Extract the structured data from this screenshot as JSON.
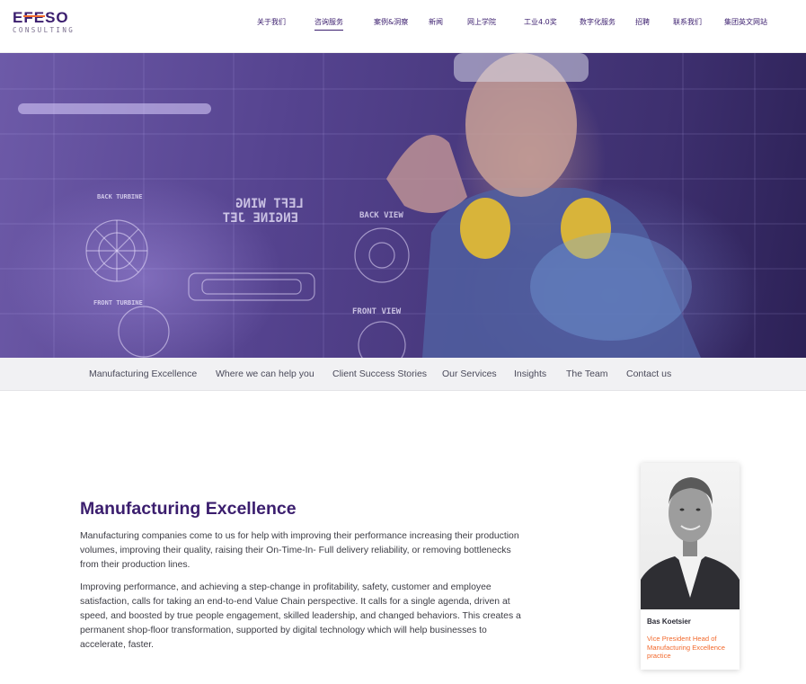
{
  "brand": {
    "logo_main": "EFESO",
    "logo_sub": "CONSULTING",
    "accent_purple": "#3b1e6e",
    "accent_orange": "#f26a2e"
  },
  "top_nav": {
    "items": [
      "关于我们",
      "咨询服务",
      "案例&洞察",
      "新闻",
      "网上学院",
      "工业4.0奖",
      "数字化服务",
      "招聘",
      "联系我们",
      "集团英文网站"
    ],
    "active": "咨询服务"
  },
  "hero": {
    "overlay_texts": [
      "LEFT WING",
      "ENGINE JET",
      "BACK VIEW",
      "FRONT VIEW",
      "BACK TURBINE",
      "FRONT TURBINE"
    ]
  },
  "sub_nav": {
    "items": [
      "Manufacturing Excellence",
      "Where we can help you",
      "Client Success Stories",
      "Our Services",
      "Insights",
      "The Team",
      "Contact us"
    ]
  },
  "main": {
    "title": "Manufacturing Excellence",
    "paragraph_1": "Manufacturing companies come to us for help with improving their performance increasing their production volumes, improving their quality, raising their On-Time-In- Full delivery reliability, or removing bottlenecks from their production lines.",
    "paragraph_2": "Improving performance, and achieving a step-change in profitability, safety, customer and employee satisfaction, calls for taking an end-to-end Value Chain perspective. It calls for a single agenda, driven at speed, and boosted by true people engagement, skilled leadership, and changed behaviors. This creates a permanent shop-floor transformation, supported by digital technology which will help businesses to accelerate, faster."
  },
  "profile_card": {
    "name": "Bas Koetsier",
    "role": "Vice President Head of Manufacturing Excellence practice"
  }
}
